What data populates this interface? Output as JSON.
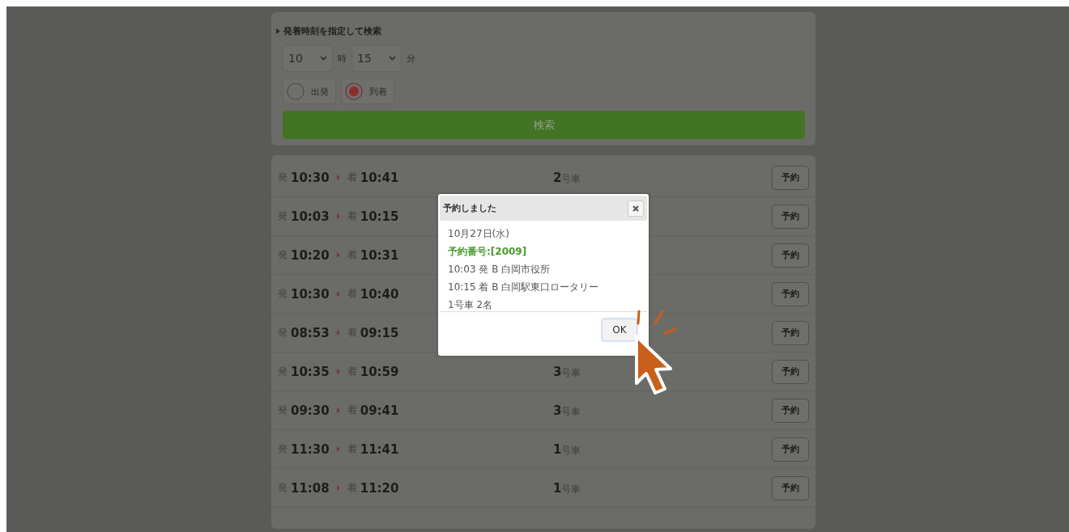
{
  "search_panel": {
    "title": "発着時刻を指定して検索",
    "hour": {
      "value": "10",
      "unit": "時"
    },
    "minute": {
      "value": "15",
      "unit": "分"
    },
    "direction": [
      {
        "label": "出発",
        "selected": false
      },
      {
        "label": "到着",
        "selected": true
      }
    ],
    "search_button": "検索"
  },
  "results": [
    {
      "dep_label": "発",
      "dep": "10:30",
      "arr_label": "着",
      "arr": "10:41",
      "car": "**2**号車",
      "button": "予約"
    },
    {
      "dep_label": "発",
      "dep": "10:03",
      "arr_label": "着",
      "arr": "10:15",
      "button": "予約"
    },
    {
      "dep_label": "発",
      "dep": "10:20",
      "arr_label": "着",
      "arr": "10:31",
      "button": "予約"
    },
    {
      "dep_label": "発",
      "dep": "10:30",
      "arr_label": "着",
      "arr": "10:40",
      "button": "予約"
    },
    {
      "dep_label": "発",
      "dep": "08:53",
      "arr_label": "着",
      "arr": "09:15",
      "button": "予約"
    },
    {
      "dep_label": "発",
      "dep": "10:35",
      "arr_label": "着",
      "arr": "10:59",
      "car": "**3**号車",
      "button": "予約"
    },
    {
      "dep_label": "発",
      "dep": "09:30",
      "arr_label": "着",
      "arr": "09:41",
      "car": "**3**号車",
      "button": "予約"
    },
    {
      "dep_label": "発",
      "dep": "11:30",
      "arr_label": "着",
      "arr": "11:41",
      "car": "**1**号車",
      "button": "予約"
    },
    {
      "dep_label": "発",
      "dep": "11:08",
      "arr_label": "着",
      "arr": "11:20",
      "car": "**1**号車",
      "button": "予約"
    }
  ],
  "dialog": {
    "title": "予約しました",
    "lines": [
      {
        "kind": "plain",
        "text": "10月27日(水)"
      },
      {
        "kind": "highlight",
        "text": "予約番号:[2009]"
      },
      {
        "kind": "plain",
        "text": "10:03 発 B 白岡市役所"
      },
      {
        "kind": "plain",
        "text": "10:15 着 B 白岡駅東口ロータリー"
      },
      {
        "kind": "plain",
        "text": "1号車 2名"
      }
    ],
    "ok_button": "OK"
  }
}
